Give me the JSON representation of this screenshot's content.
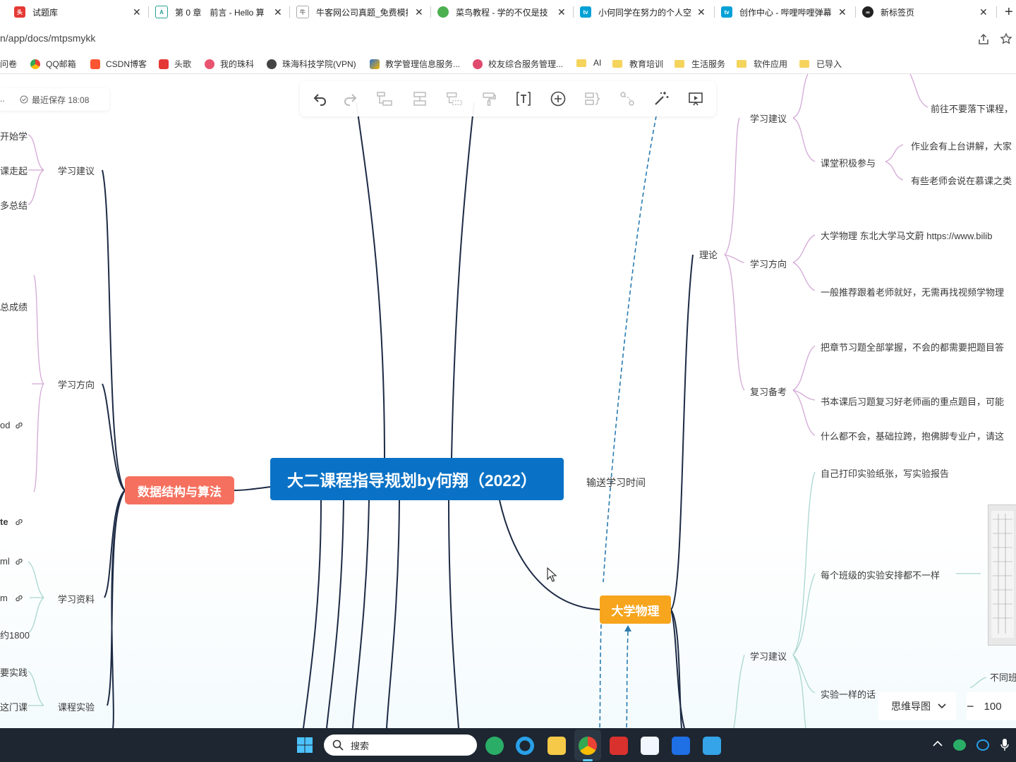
{
  "browser": {
    "tabs": [
      {
        "title": "试题库",
        "favicon": "toutiao-icon",
        "color": "#e53935"
      },
      {
        "title": "第 0 章　前言 - Hello 算",
        "favicon": "hello-algo-icon",
        "color": "#2aa198"
      },
      {
        "title": "牛客网公司真题_免费模拟",
        "favicon": "nowcoder-icon",
        "color": "#7a7a7a"
      },
      {
        "title": "菜鸟教程 - 学的不仅是技",
        "favicon": "runoob-icon",
        "color": "#4caf50"
      },
      {
        "title": "小何同学在努力的个人空",
        "favicon": "bilibili-icon",
        "color": "#00a1d6"
      },
      {
        "title": "创作中心 - 哔哩哔哩弹幕",
        "favicon": "bilibili-icon",
        "color": "#00a1d6"
      },
      {
        "title": "新标签页",
        "favicon": "new-tab-icon",
        "color": "#222222"
      }
    ],
    "url": "n/app/docs/mtpsmykk",
    "bookmarks": [
      {
        "label": "问卷",
        "type": "site",
        "color": "#4a90d9"
      },
      {
        "label": "QQ邮箱",
        "type": "site",
        "color": "#3db34a"
      },
      {
        "label": "CSDN博客",
        "type": "site",
        "color": "#fc5531"
      },
      {
        "label": "头歌",
        "type": "site",
        "color": "#e53935"
      },
      {
        "label": "我的珠科",
        "type": "site",
        "color": "#e8546e"
      },
      {
        "label": "珠海科技学院(VPN)",
        "type": "site",
        "color": "#444444"
      },
      {
        "label": "教学管理信息服务...",
        "type": "site",
        "color": "#2a6fd1"
      },
      {
        "label": "校友综合服务管理...",
        "type": "site",
        "color": "#e04a6e"
      },
      {
        "label": "AI",
        "type": "folder"
      },
      {
        "label": "教育培训",
        "type": "folder"
      },
      {
        "label": "生活服务",
        "type": "folder"
      },
      {
        "label": "软件应用",
        "type": "folder"
      },
      {
        "label": "已导入",
        "type": "folder"
      }
    ]
  },
  "editor": {
    "save_status": "最近保存 18:08",
    "save_prefix": "..",
    "mode_label": "思维导图",
    "zoom_label": "100",
    "toolbar": [
      "undo-icon",
      "redo-icon",
      "child-node-icon",
      "sibling-node-icon",
      "parent-node-icon",
      "format-painter-icon",
      "text-icon",
      "insert-icon",
      "summary-icon",
      "link-icon",
      "magic-icon",
      "present-icon"
    ]
  },
  "mindmap": {
    "root": "大二课程指导规划by何翔（2022）",
    "left_branch": "数据结构与算法",
    "right_branch": "大学物理",
    "relation_label": "输送学习时间",
    "left_nodes": {
      "study_advice": "学习建议",
      "study_direction": "学习方向",
      "study_materials": "学习资料",
      "course_lab": "课程实验"
    },
    "left_fragments": [
      "开始学",
      "课走起",
      "多总结",
      "总成绩",
      "od",
      "te",
      "ml",
      "m",
      "约1800",
      "要实践",
      "这门课"
    ],
    "physics": {
      "theory": "理论",
      "study_advice": "学习建议",
      "study_direction": "学习方向",
      "review": "复习备考",
      "lab_advice": "学习建议",
      "partial_top": "前往不要落下课程，",
      "class_participation": "课堂积极参与",
      "participation_1": "作业会有上台讲解，大家",
      "participation_2": "有些老师会说在慕课之类",
      "direction_1": "大学物理 东北大学马文蔚 https://www.bilib",
      "direction_2": "一般推荐跟着老师就好，无需再找视频学物理",
      "review_1": "把章节习题全部掌握，不会的都需要把题目答",
      "review_2": "书本课后习题复习好老师画的重点题目，可能",
      "review_3": "什么都不会，基础拉跨，抱佛脚专业户，请这",
      "lab_1": "自己打印实验纸张，写实验报告",
      "lab_2": "每个班级的实验安排都不一样",
      "lab_3": "实验一样的话",
      "lab_4": "不同班"
    }
  },
  "taskbar": {
    "search_placeholder": "搜索",
    "apps": [
      "windows-start-icon",
      "wechat-icon",
      "edge-like-icon",
      "file-explorer-icon",
      "chrome-icon",
      "wps-icon",
      "baidu-netdisk-icon",
      "whiteboard-icon",
      "screenshot-icon"
    ],
    "tray": [
      "chevron-up-icon",
      "wechat-tray-icon",
      "network-icon",
      "microphone-icon"
    ]
  }
}
